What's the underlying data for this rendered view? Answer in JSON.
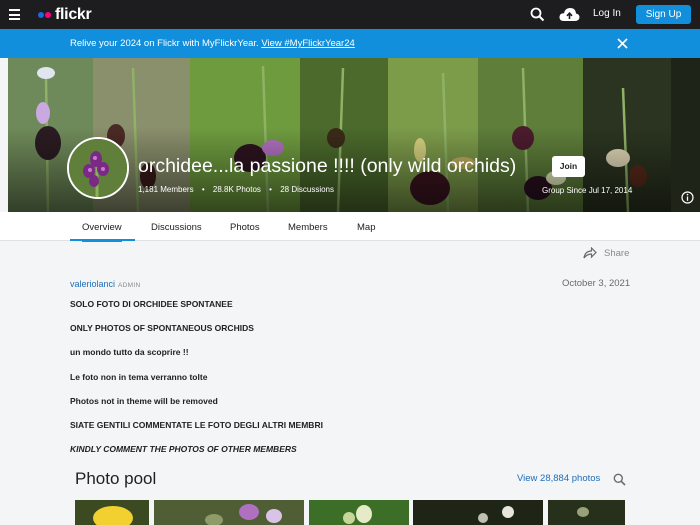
{
  "nav": {
    "logo_text": "flickr",
    "login_label": "Log In",
    "signup_label": "Sign Up"
  },
  "banner": {
    "text": "Relive your 2024 on Flickr with MyFlickrYear.",
    "link_text": "View #MyFlickrYear24"
  },
  "group": {
    "title": "orchidee...la passione !!!! (only wild orchids)",
    "members": "1,181 Members",
    "photos": "28.8K Photos",
    "discussions": "28 Discussions",
    "join_label": "Join",
    "since": "Group Since Jul 17, 2014"
  },
  "tabs": [
    {
      "label": "Overview"
    },
    {
      "label": "Discussions"
    },
    {
      "label": "Photos"
    },
    {
      "label": "Members"
    },
    {
      "label": "Map"
    }
  ],
  "share_label": "Share",
  "post": {
    "author": "valeriolanci",
    "role": "ADMIN",
    "date": "October 3, 2021",
    "lines": [
      "SOLO FOTO DI ORCHIDEE SPONTANEE",
      "ONLY PHOTOS OF SPONTANEOUS ORCHIDS",
      "un mondo tutto da scoprire !!",
      "Le foto non in tema verranno tolte",
      "Photos not in theme will be removed",
      "SIATE GENTILI COMMENTATE LE FOTO DEGLI ALTRI MEMBRI",
      "KINDLY COMMENT THE PHOTOS OF OTHER MEMBERS"
    ]
  },
  "pool": {
    "title": "Photo pool",
    "view_all": "View 28,884 photos"
  },
  "colors": {
    "nav_bg": "#1d1d1f",
    "brand_blue": "#128fdc",
    "flickr_pink": "#ff0084",
    "link": "#1f6db8"
  },
  "icons": [
    "hamburger-icon",
    "search-icon",
    "upload-cloud-icon",
    "close-icon",
    "info-icon",
    "share-icon"
  ]
}
